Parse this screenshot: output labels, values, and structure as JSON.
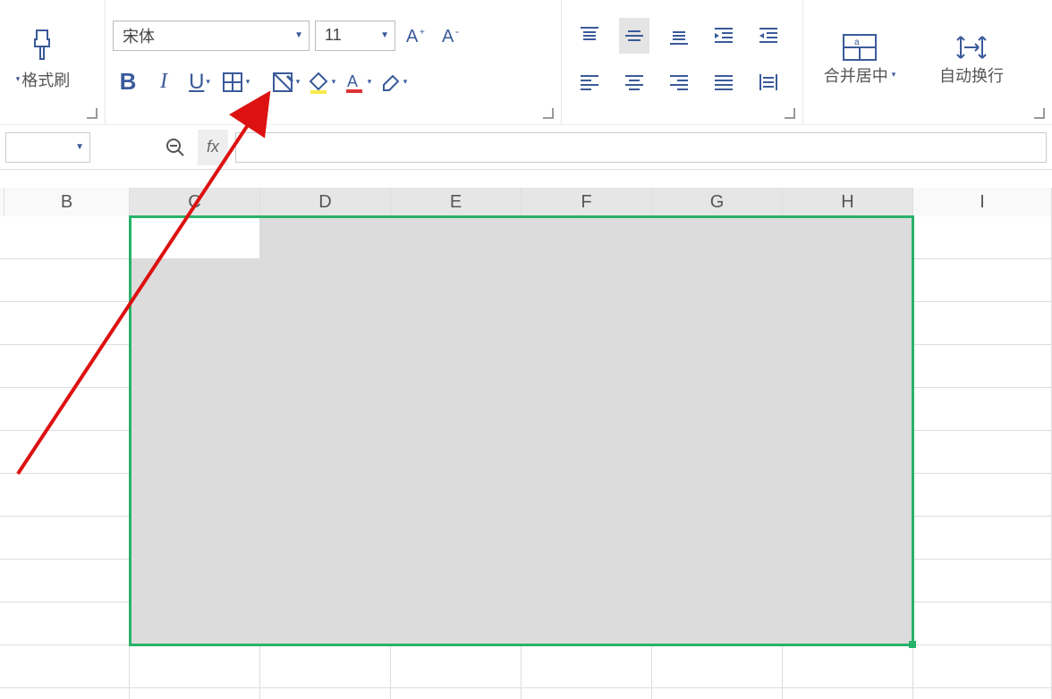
{
  "ribbon": {
    "format_painter": {
      "label": "格式刷"
    },
    "font": {
      "font_name": "宋体",
      "font_size": "11"
    },
    "merge_center": {
      "label": "合并居中"
    },
    "wrap_text": {
      "label": "自动换行"
    }
  },
  "columns": [
    "B",
    "C",
    "D",
    "E",
    "F",
    "G",
    "H",
    "I"
  ],
  "col_widths": {
    "margin": 5,
    "B": 140,
    "C": 146,
    "D": 146,
    "E": 146,
    "F": 146,
    "G": 146,
    "H": 146,
    "I": 155
  },
  "selection": {
    "start_col": "C",
    "end_col": "H",
    "rows": 10
  },
  "colors": {
    "selection_border": "#27b36a",
    "selected_cell": "#dcdcdc",
    "accent": "#3a5a9a"
  }
}
